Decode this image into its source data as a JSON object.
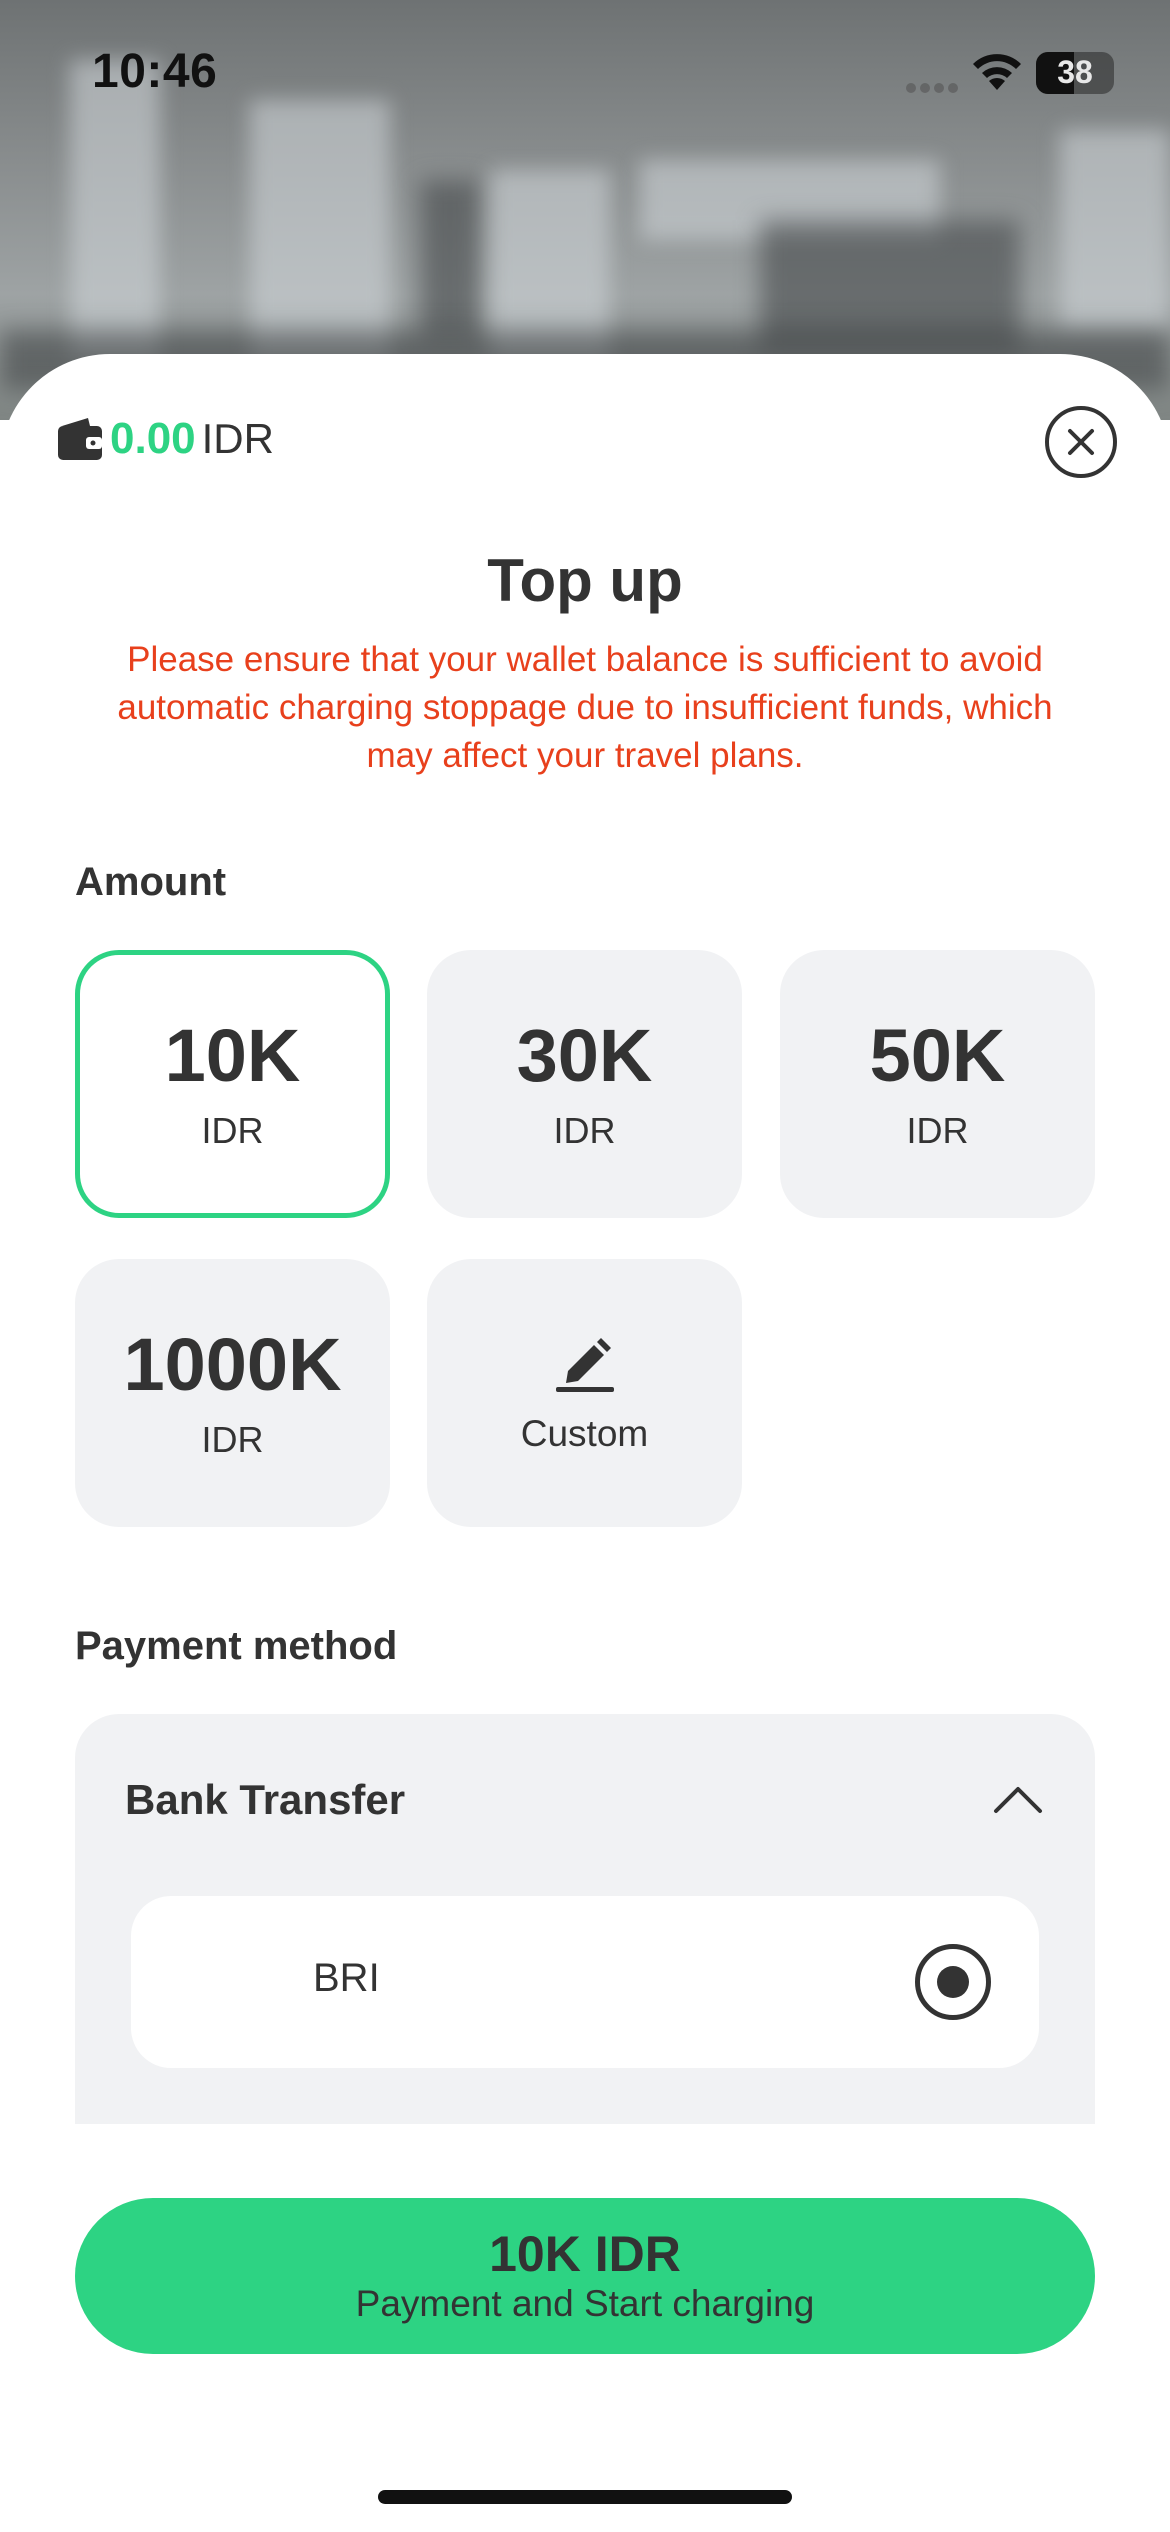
{
  "status_bar": {
    "time": "10:46",
    "battery": "38"
  },
  "wallet": {
    "balance": "0.00",
    "currency": "IDR"
  },
  "header": {
    "title": "Top up",
    "warning": "Please ensure that your wallet balance is sufficient to avoid automatic charging stoppage due to insufficient funds, which may affect your travel plans."
  },
  "amount": {
    "label": "Amount",
    "options": [
      {
        "value": "10K",
        "unit": "IDR",
        "selected": true
      },
      {
        "value": "30K",
        "unit": "IDR",
        "selected": false
      },
      {
        "value": "50K",
        "unit": "IDR",
        "selected": false
      },
      {
        "value": "1000K",
        "unit": "IDR",
        "selected": false
      }
    ],
    "custom_label": "Custom"
  },
  "payment": {
    "label": "Payment method",
    "method": "Bank Transfer",
    "bank": "BRI"
  },
  "pay_button": {
    "amount": "10K IDR",
    "caption": "Payment and Start charging"
  },
  "colors": {
    "accent": "#2dd383",
    "warning": "#e8401c",
    "card": "#f1f2f4",
    "text": "#333333"
  }
}
